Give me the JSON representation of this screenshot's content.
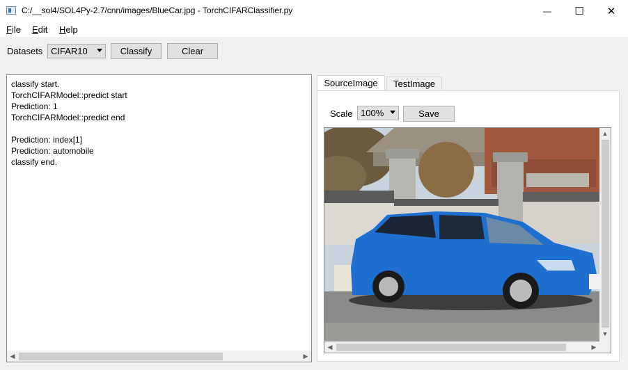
{
  "window": {
    "title": "C:/__sol4/SOL4Py-2.7/cnn/images/BlueCar.jpg - TorchCIFARClassifier.py",
    "minimize_glyph": "—",
    "maximize_glyph": "☐",
    "close_glyph": "✕"
  },
  "menu": [
    {
      "key": "F",
      "rest": "ile"
    },
    {
      "key": "E",
      "rest": "dit"
    },
    {
      "key": "H",
      "rest": "elp"
    }
  ],
  "toolbar": {
    "datasets_label": "Datasets",
    "dataset_value": "CIFAR10",
    "classify_label": "Classify",
    "clear_label": "Clear"
  },
  "log": {
    "lines": [
      "classify start.",
      "TorchCIFARModel::predict start",
      "Prediction: 1",
      "TorchCIFARModel::predict end",
      "",
      "Prediction: index[1]",
      "Prediction: automobile",
      "classify end."
    ]
  },
  "tabs": [
    {
      "label": "SourceImage",
      "active": true
    },
    {
      "label": "TestImage",
      "active": false
    }
  ],
  "viewer": {
    "scale_label": "Scale",
    "scale_value": "100%",
    "save_label": "Save"
  },
  "icons": {
    "app": "window-icon",
    "left": "◀",
    "right": "▶",
    "up": "▲",
    "down": "▼"
  }
}
